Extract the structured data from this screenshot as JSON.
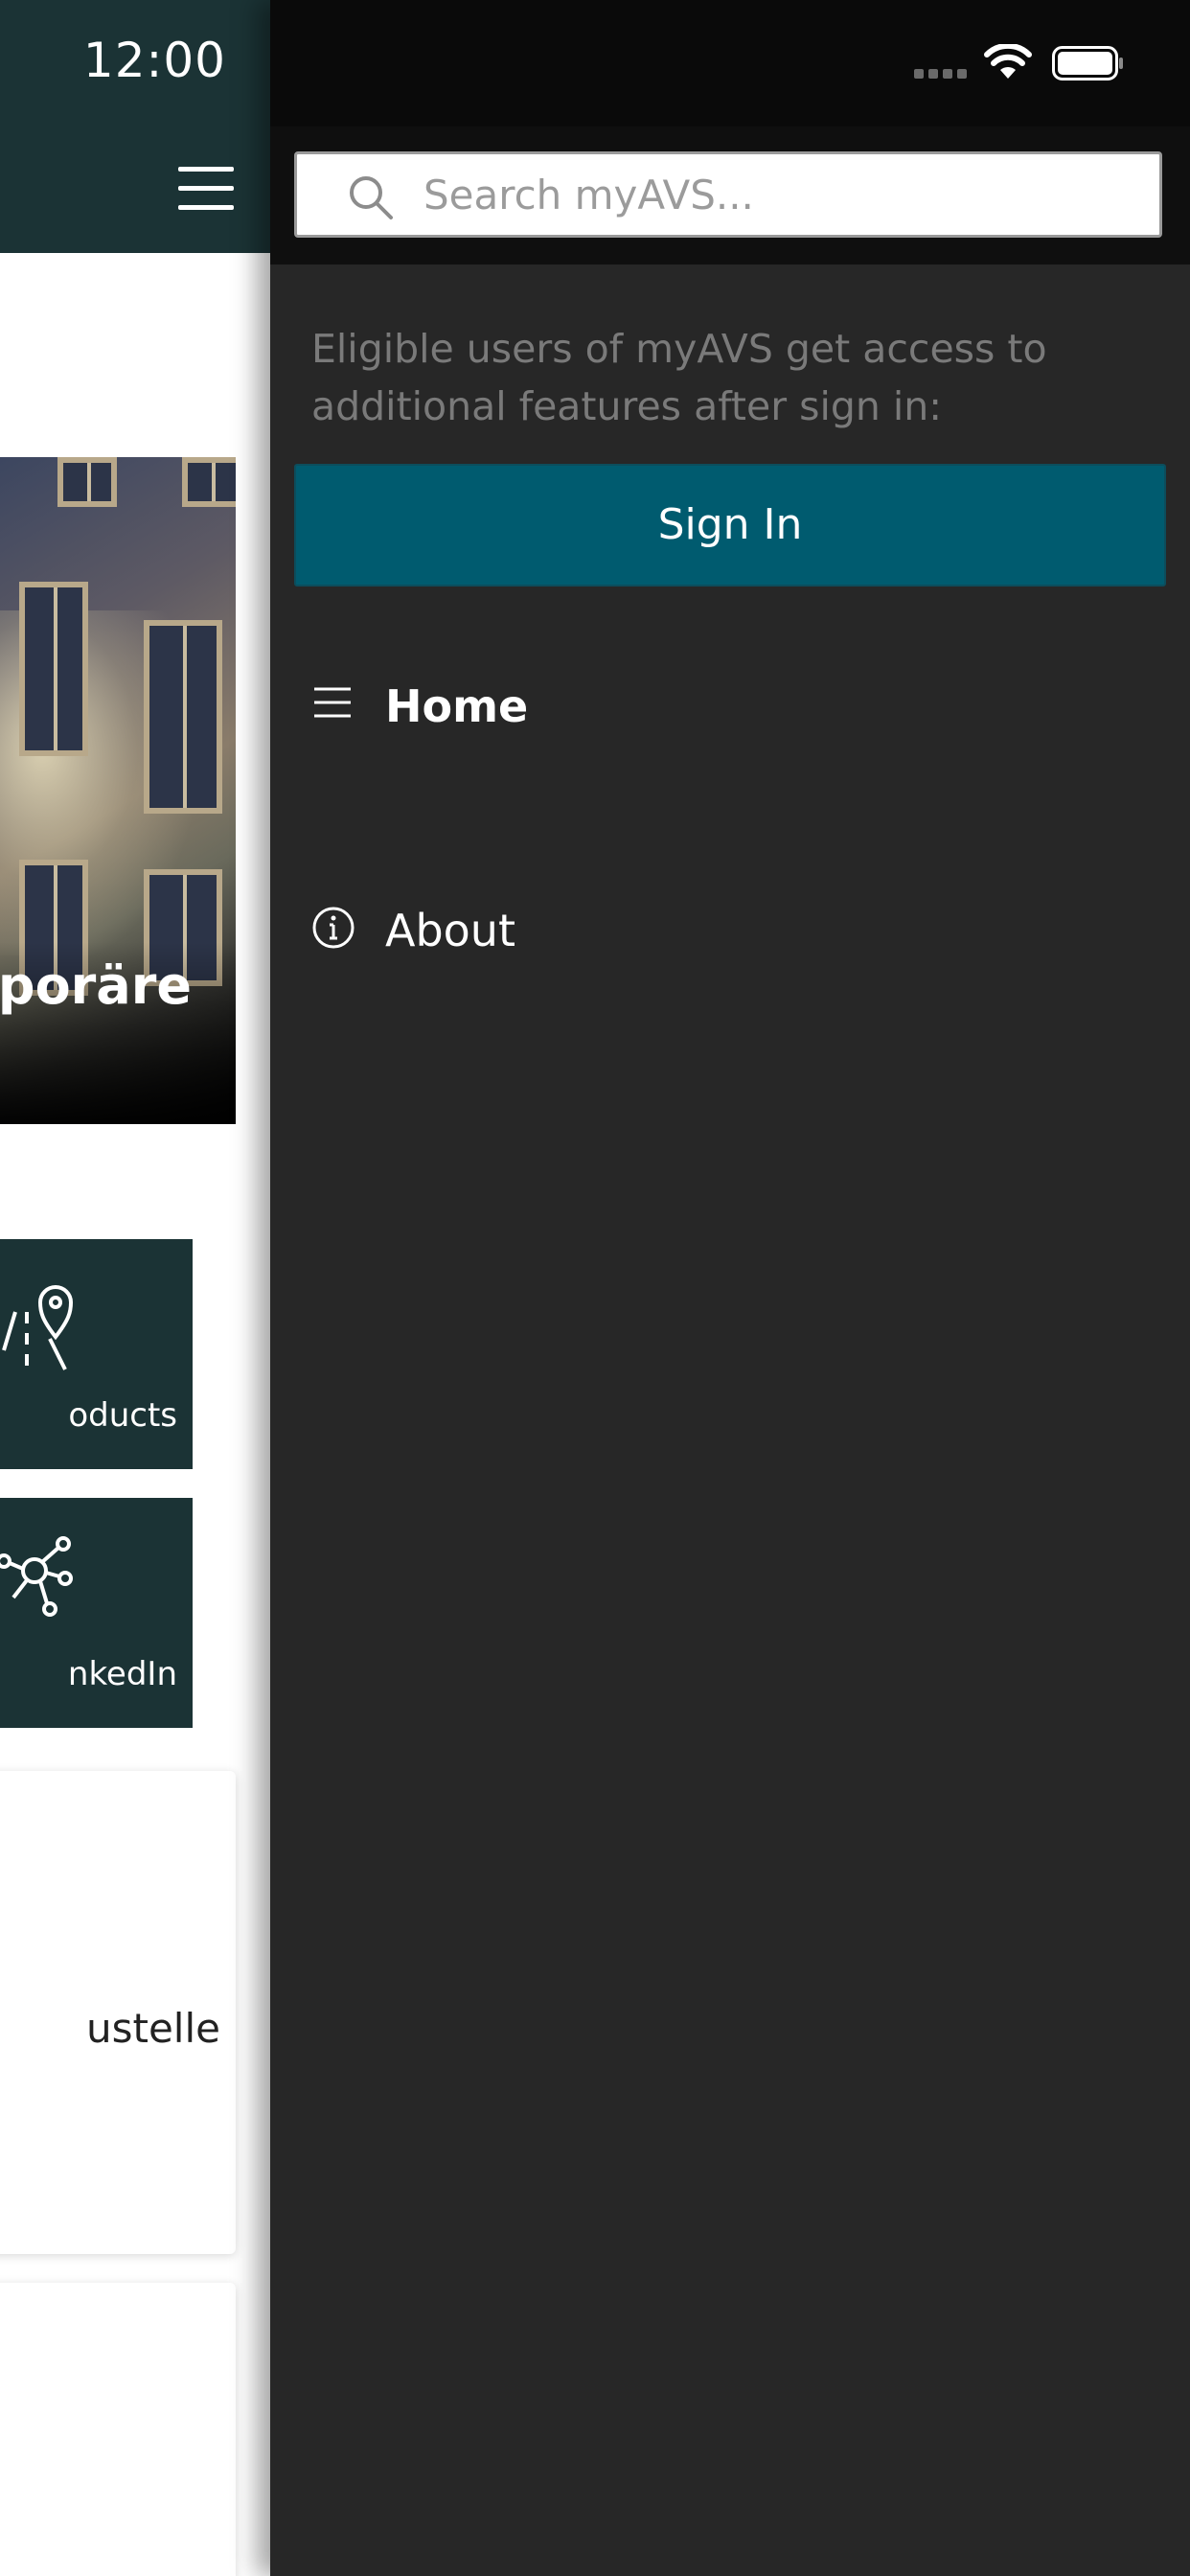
{
  "status_bar": {
    "time": "12:00"
  },
  "app": {
    "hero_title": "nporäre",
    "tiles": [
      {
        "label": "oducts",
        "icon": "map-pin-road-icon"
      },
      {
        "label": "nkedIn",
        "icon": "network-nodes-icon"
      }
    ],
    "card_1_text": "ustelle"
  },
  "drawer": {
    "search": {
      "placeholder": "Search myAVS...",
      "value": ""
    },
    "info_text": "Eligible users of myAVS get access to additional features after sign in:",
    "sign_in_label": "Sign In",
    "nav": [
      {
        "label": "Home",
        "icon": "list-icon",
        "active": true
      },
      {
        "label": "About",
        "icon": "info-circle-icon",
        "active": false
      }
    ]
  },
  "colors": {
    "header_bg": "#1b3335",
    "drawer_bg": "#272727",
    "sign_in_bg": "#005b6f",
    "tile_bg": "#1b3335"
  }
}
